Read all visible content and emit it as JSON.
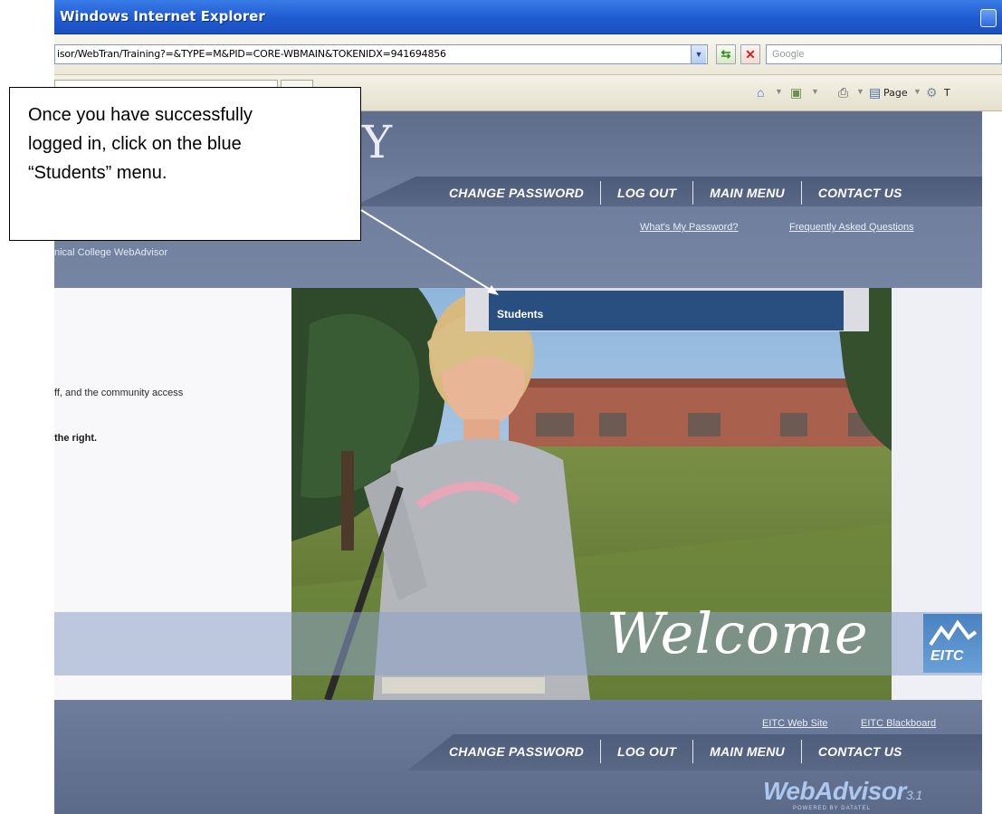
{
  "browser": {
    "window_title": "Windows Internet Explorer",
    "address": "isor/WebTran/Training?=&TYPE=M&PID=CORE-WBMAIN&TOKENIDX=941694856",
    "search_placeholder": "Google",
    "page_label": "Page",
    "tools_label": "T"
  },
  "header": {
    "logo_letter": "Y",
    "college_name": "nical College WebAdvisor",
    "nav": [
      "Change Password",
      "Log Out",
      "Main Menu",
      "Contact Us"
    ],
    "sublinks": [
      "What's My Password?",
      "Frequently Asked Questions"
    ]
  },
  "main": {
    "intro_line": "ff, and the community access",
    "intro_bold": "the right.",
    "students_menu": "Students",
    "welcome": "Welcome",
    "logo_text": "EITC"
  },
  "footer": {
    "sublinks": [
      "EITC Web Site",
      "EITC Blackboard"
    ],
    "nav": [
      "Change Password",
      "Log Out",
      "Main Menu",
      "Contact Us"
    ],
    "brand": "WebAdvisor",
    "version": "3.1",
    "powered": "POWERED BY DATATEL"
  },
  "callout": {
    "lines": [
      "Once you have successfully",
      "logged in, click on the blue",
      "“Students” menu."
    ]
  },
  "colors": {
    "header_bg": "#6e7d9b",
    "students_bar": "#284f80",
    "ie_titlebar": "#1f5bd0"
  }
}
